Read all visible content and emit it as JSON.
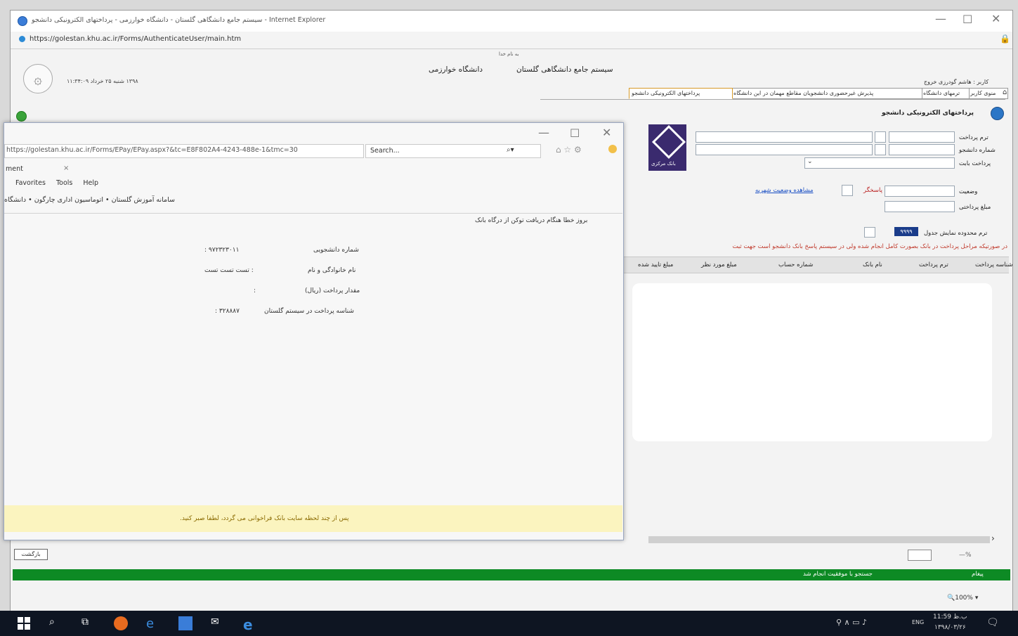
{
  "ie_title": "سیستم جامع دانشگاهی گلستان - دانشگاه خوارزمی - پرداختهای الکترونیکی دانشجو - Internet Explorer",
  "ie_url": "https://golestan.khu.ac.ir/Forms/AuthenticateUser/main.htm",
  "header": {
    "small_top": "به نام خدا",
    "system_title": "سیستم جامع دانشگاهی گلستان",
    "university": "دانشگاه خوارزمی",
    "date_left": "۱۳۹۸ شنبه ۲۵ خرداد ۱۱:۳۴:۰۹",
    "user_links": "کاربر : هاشم گودرزی   خروج"
  },
  "tabs": [
    "منوی کاربر",
    "ترمهای دانشگاه",
    "پذیرش غیرحضوری دانشجویان مقاطع مهمان در این دانشگاه",
    "پرداختهای الکترونیکی دانشجو"
  ],
  "form": {
    "section_title": "پرداختهای الکترونیکی دانشجو",
    "term_label": "ترم پرداخت",
    "student_no_label": "شماره دانشجو",
    "payment_for_label": "پرداخت بابت",
    "status_label": "وضعیت",
    "amount_label": "مبلغ پرداختی",
    "receipt_label": "پاسخگر",
    "view_link": "مشاهده وضعیت شهریه",
    "page_count_label": "ترم محدوده نمایش جدول",
    "page_value": "۹۹۹۹",
    "warning": "در صورتیکه مراحل پرداخت در بانک بصورت کامل انجام شده ولی در سیستم پاسخ بانک دانشجو است جهت ثبت",
    "bank_label": "بانک مرکزی"
  },
  "table_headers": [
    "شناسه پرداخت",
    "ترم پرداخت",
    "نام بانک",
    "شماره حساب",
    "مبلغ مورد نظر",
    "مبلغ تایید شده"
  ],
  "footer": {
    "status_green": "جستجو با موفقیت انجام شد",
    "message_label": "پیغام",
    "back_button": "بازگشت",
    "zoom": "100%",
    "zoom_icon": "zoom-icon"
  },
  "popup": {
    "url": "https://golestan.khu.ac.ir/Forms/EPay/EPay.aspx?&tc=E8F802A4-4243-488e-1&tmc=30",
    "search_placeholder": "Search...",
    "tab_name": "ment",
    "menu": [
      "Favorites",
      "Tools",
      "Help"
    ],
    "favorites_bar": [
      "سامانه آموزش گلستان",
      "اتوماسیون اداری چارگون",
      "دانشگاه"
    ],
    "notice": "بروز خطا هنگام دریافت توکن از درگاه بانک",
    "rows": [
      {
        "label": "شماره دانشجویی",
        "value": "۹۷۲۳۲۳۰۱۱ :"
      },
      {
        "label": "نام خانوادگی و نام",
        "value": ": تست تست تست"
      },
      {
        "label": "مقدار پرداخت (ریال)",
        "value": ":"
      },
      {
        "label": "شناسه پرداخت در سیستم گلستان",
        "value": "۳۲۸۸۸۷ :"
      }
    ],
    "bottom_notice": "پس از چند لحظه سایت بانک فراخوانی می گردد، لطفا صبر کنید."
  },
  "taskbar": {
    "lang": "ENG",
    "time": "11:59 ب.ظ",
    "date": "۱۳۹۸/۰۳/۲۶"
  },
  "colors": {
    "green_bar": "#0d8a24",
    "yellow_notice": "#fbf4bf",
    "taskbar": "#0e1522",
    "accent_red": "#c0392b"
  }
}
